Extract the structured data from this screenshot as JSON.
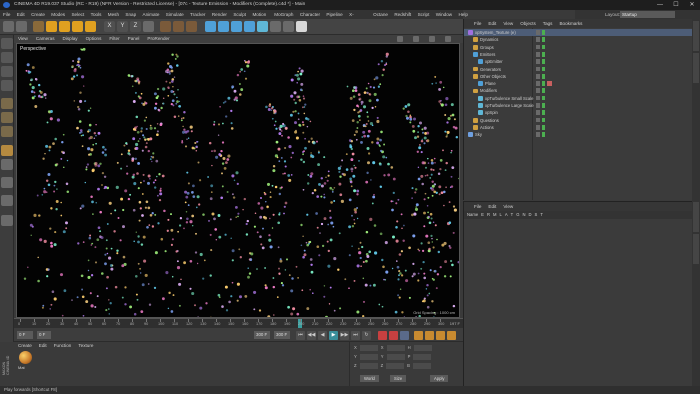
{
  "window": {
    "title": "CINEMA 4D R19.037 Studio (RC - R19) (NFR Version - Restricted License) - [07c - Texture Emission - Modifiers (Complete).c4d *] - Main",
    "controls": [
      "—",
      "☐",
      "✕"
    ]
  },
  "menubar": [
    "File",
    "Edit",
    "Create",
    "Modes",
    "Select",
    "Tools",
    "Mesh",
    "Snap",
    "Animate",
    "Simulate",
    "Tracker",
    "Render",
    "Sculpt",
    "Motion Tracker",
    "MoGraph",
    "Character",
    "Pipeline",
    "X-Particles",
    "Octane",
    "Redshift",
    "Script",
    "Window",
    "Help"
  ],
  "layout": {
    "label": "Layout:",
    "value": "Startup"
  },
  "viewport": {
    "menu": [
      "View",
      "Cameras",
      "Display",
      "Options",
      "Filter",
      "Panel",
      "ProRender"
    ],
    "label": "Perspective",
    "status": "Grid Spacing : 1000 cm"
  },
  "timeline": {
    "ticks": [
      "0",
      "10",
      "20",
      "30",
      "40",
      "50",
      "60",
      "70",
      "80",
      "90",
      "100",
      "110",
      "120",
      "130",
      "140",
      "150",
      "160",
      "170",
      "180",
      "190",
      "200",
      "210",
      "220",
      "230",
      "240",
      "250",
      "260",
      "270",
      "280",
      "290",
      "300"
    ],
    "end_label": "197 F"
  },
  "transport": {
    "start_field": "0 F",
    "current_field": "0 F",
    "end_field": "300 F",
    "end_field2": "300 F",
    "buttons": [
      "⏮",
      "◀◀",
      "◀",
      "▶",
      "▶▶",
      "⏭",
      "↻"
    ]
  },
  "material": {
    "menu": [
      "Create",
      "Edit",
      "Function",
      "Texture"
    ],
    "name": "Mat"
  },
  "coords": {
    "rows": [
      {
        "a": "X",
        "b": "X",
        "c": "H"
      },
      {
        "a": "Y",
        "b": "Y",
        "c": "P"
      },
      {
        "a": "Z",
        "b": "Z",
        "c": "B"
      }
    ],
    "mode": "World",
    "size_mode": "Size",
    "apply": "Apply"
  },
  "maxon_label": "MAXON CINEMA 4D",
  "statusbar": "Play forwards [Shortcut F8]",
  "object_manager": {
    "menu": [
      "File",
      "Edit",
      "View",
      "Objects",
      "Tags",
      "Bookmarks"
    ],
    "items": [
      {
        "name": "xpSystem_Texture (e)",
        "indent": 0,
        "color": "#a070e0",
        "selected": true
      },
      {
        "name": "Dynamics",
        "indent": 1,
        "color": "#d0a040",
        "selected": false
      },
      {
        "name": "Groups",
        "indent": 1,
        "color": "#d0a040",
        "selected": false
      },
      {
        "name": "Emitters",
        "indent": 1,
        "color": "#4fa0d8",
        "selected": false
      },
      {
        "name": "xpEmitter",
        "indent": 2,
        "color": "#4fa0d8",
        "selected": false
      },
      {
        "name": "Generators",
        "indent": 1,
        "color": "#d0a040",
        "selected": false
      },
      {
        "name": "Other Objects",
        "indent": 1,
        "color": "#d0a040",
        "selected": false
      },
      {
        "name": "Plane",
        "indent": 2,
        "color": "#4fa0d8",
        "selected": false
      },
      {
        "name": "Modifiers",
        "indent": 1,
        "color": "#d0a040",
        "selected": false
      },
      {
        "name": "xpTurbulence Small Scale",
        "indent": 2,
        "color": "#5fb7d6",
        "selected": false
      },
      {
        "name": "xpTurbulence Large Scale",
        "indent": 2,
        "color": "#5fb7d6",
        "selected": false
      },
      {
        "name": "xpSpin",
        "indent": 2,
        "color": "#5fb7d6",
        "selected": false
      },
      {
        "name": "Questions",
        "indent": 1,
        "color": "#d0a040",
        "selected": false
      },
      {
        "name": "Actions",
        "indent": 1,
        "color": "#d0a040",
        "selected": false
      },
      {
        "name": "Sky",
        "indent": 0,
        "color": "#6fa0e0",
        "selected": false
      }
    ]
  },
  "attribute_manager": {
    "menu": [
      "File",
      "Edit",
      "View"
    ],
    "head": [
      "Name",
      "E",
      "R",
      "M",
      "L",
      "A",
      "T",
      "G",
      "N",
      "D",
      "S",
      "T"
    ]
  },
  "colors": {
    "accent_selection": "#4d5d77",
    "viewport_bg": "#030303",
    "timeline_playhead": "#3aa0a0"
  }
}
